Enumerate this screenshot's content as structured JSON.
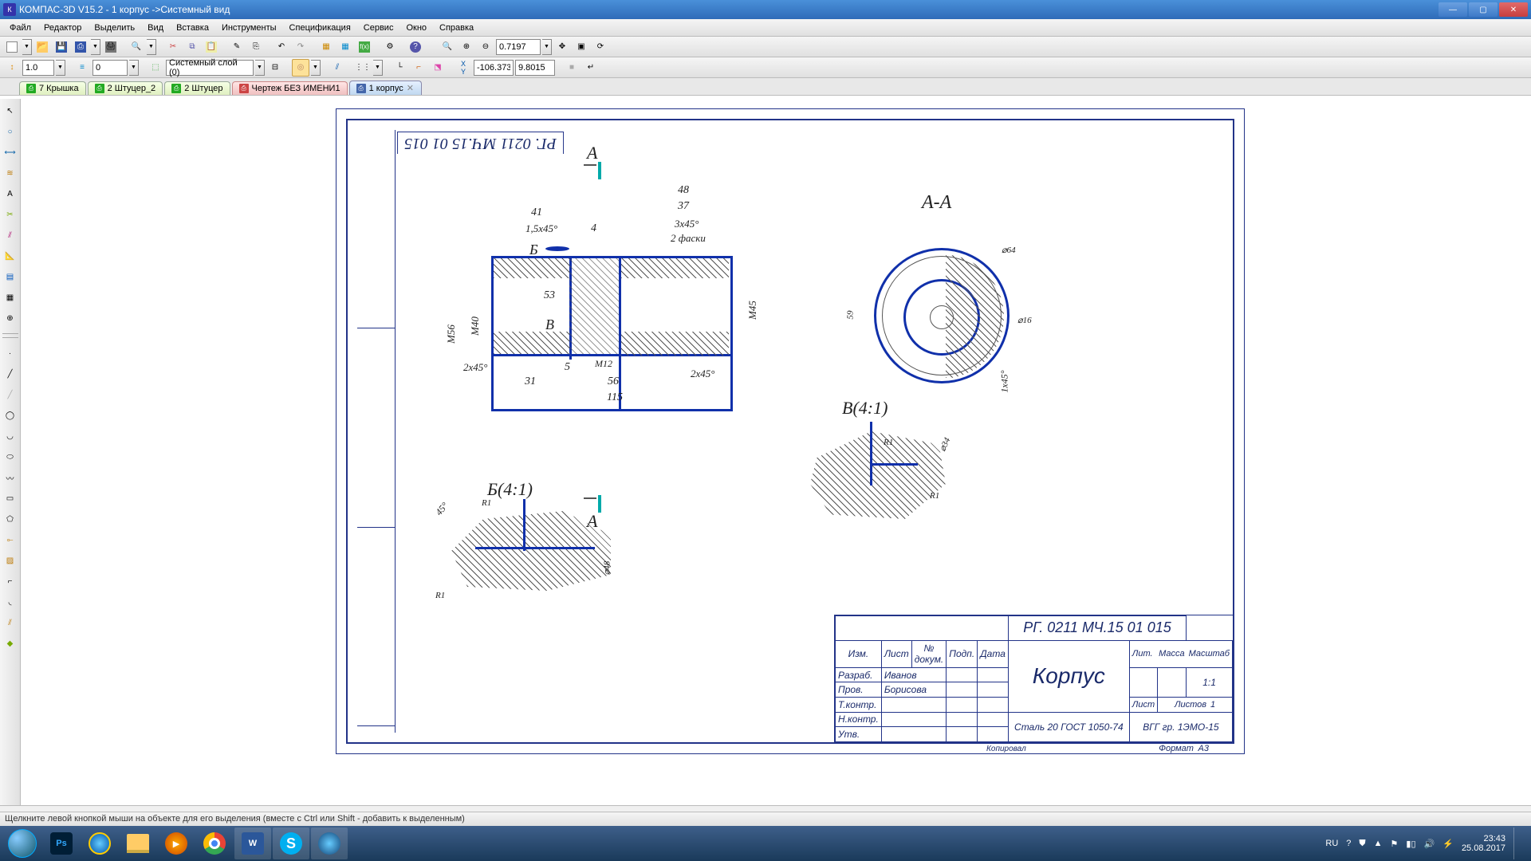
{
  "window": {
    "title": "КОМПАС-3D V15.2  - 1 корпус ->Системный вид"
  },
  "menu": {
    "file": "Файл",
    "editor": "Редактор",
    "select": "Выделить",
    "view": "Вид",
    "insert": "Вставка",
    "tools": "Инструменты",
    "spec": "Спецификация",
    "service": "Сервис",
    "window": "Окно",
    "help": "Справка"
  },
  "toolbar2": {
    "stepValue": "1.0",
    "styleValue": "0",
    "layerLabel": "Системный слой (0)",
    "coordX": "-106.373",
    "coordY": "9.8015",
    "zoom": "0.7197"
  },
  "tabs": [
    {
      "label": "7 Крышка",
      "type": "green"
    },
    {
      "label": "2 Штуцер_2",
      "type": "green"
    },
    {
      "label": "2 Штуцер",
      "type": "green"
    },
    {
      "label": "Чертеж БЕЗ ИМЕНИ1",
      "type": "red"
    },
    {
      "label": "1 корпус",
      "type": "active"
    }
  ],
  "status": {
    "text": "Щелкните левой кнопкой мыши на объекте для его выделения (вместе с Ctrl или Shift - добавить к выделенным)"
  },
  "tray": {
    "lang": "RU",
    "time": "23:43",
    "date": "25.08.2017"
  },
  "drawing": {
    "topCode": "РГ. 0211 МЧ.15  01  015",
    "sectionA": "А",
    "sectionAA": "А-А",
    "detailBs": "Б(4:1)",
    "detailVs": "В(4:1)",
    "dims": {
      "d48": "48",
      "d37": "37",
      "d41": "41",
      "d15x45": "1,5х45°",
      "d4": "4",
      "d3x45": "3х45°",
      "faska2": "2 фаски",
      "d53": "53",
      "dM40": "М40",
      "dM56": "М56",
      "dM45": "М45",
      "dM12": "М12",
      "d2x45a": "2х45°",
      "d2x45b": "2х45°",
      "d31": "31",
      "d5": "5",
      "d56": "56",
      "d115": "115",
      "d59": "59",
      "d64": "⌀64",
      "d16": "⌀16",
      "d1x45": "1х45°",
      "dR1a": "R1",
      "dR1b": "R1",
      "dR1c": "R1",
      "dR1d": "R1",
      "d34": "⌀34",
      "d48b": "⌀48",
      "d45deg": "45°",
      "letterB": "Б",
      "letterV": "В"
    },
    "stamp": {
      "code": "РГ. 0211  МЧ.15   01  015",
      "name": "Корпус",
      "scale": "1:1",
      "material": "Сталь 20 ГОСТ 1050-74",
      "group": "ВГГ гр. 1ЭМО-15",
      "lit": "Лит.",
      "mass": "Масса",
      "mscale": "Масштаб",
      "sheet": "Лист",
      "sheets": "Листов",
      "sheetN": "1",
      "izm": "Изм.",
      "list": "Лист",
      "ndoc": "№ докум.",
      "sign": "Подп.",
      "date": "Дата",
      "razrab": "Разраб.",
      "prov": "Пров.",
      "tkontr": "Т.контр.",
      "nkontr": "Н.контр.",
      "utv": "Утв.",
      "dev": "Иванов",
      "chk": "Борисова",
      "copy": "Копировал",
      "fmt": "Формат",
      "fmtv": "А3"
    }
  }
}
